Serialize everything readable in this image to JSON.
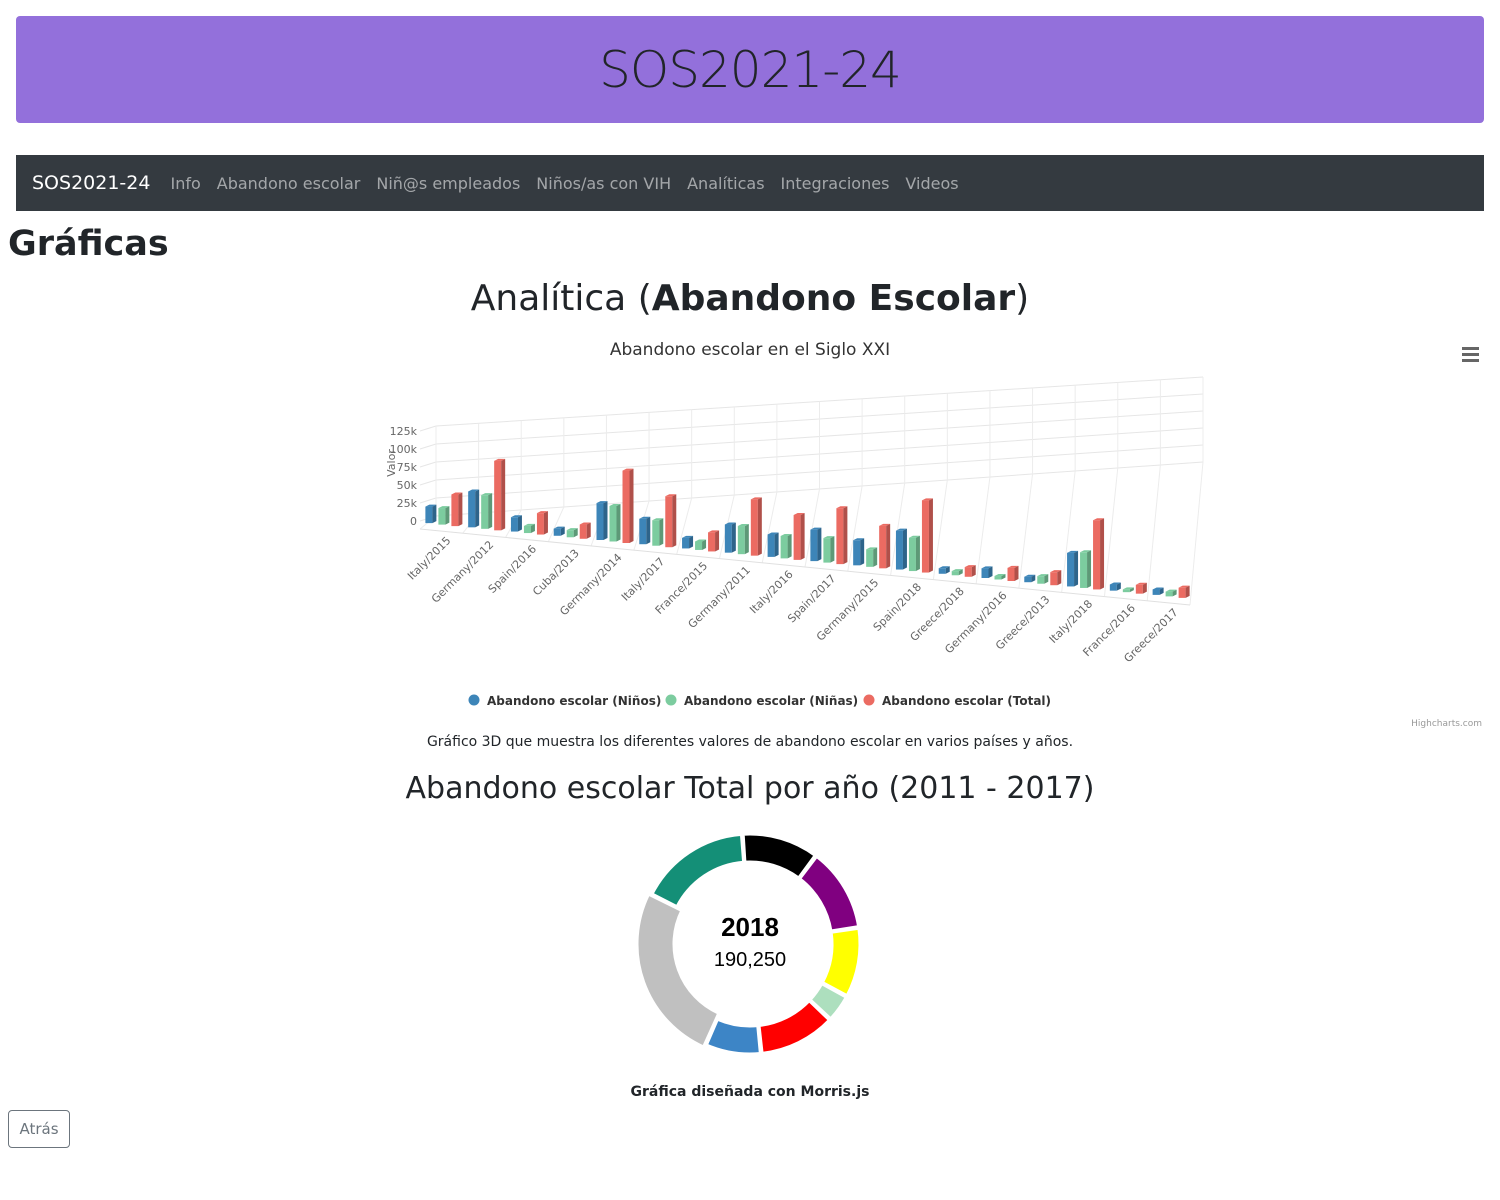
{
  "banner": {
    "title": "SOS2021-24"
  },
  "nav": {
    "brand": "SOS2021-24",
    "links": [
      "Info",
      "Abandono escolar",
      "Niñ@s empleados",
      "Niños/as con VIH",
      "Analíticas",
      "Integraciones",
      "Videos"
    ]
  },
  "page": {
    "heading": "Gráficas",
    "section1_prefix": "Analítica (",
    "section1_bold": "Abandono Escolar",
    "section1_suffix": ")",
    "chart1_description": "Gráfico 3D que muestra los diferentes valores de abandono escolar en varios países y años.",
    "section2_title": "Abandono escolar Total por año (2011 - 2017)",
    "morris_caption": "Gráfica diseñada con Morris.js",
    "back_button": "Atrás"
  },
  "colors": {
    "banner": "#9370db",
    "navbar": "#343a40",
    "ninos": "#3d85b8",
    "ninas": "#7ccc9f",
    "total": "#eb6b62"
  },
  "chart_data": [
    {
      "type": "bar",
      "title": "Abandono escolar en el Siglo XXI",
      "ylabel": "Valor",
      "ylim": [
        0,
        125000
      ],
      "yticks": [
        "0",
        "25k",
        "50k",
        "75k",
        "100k",
        "125k"
      ],
      "credits": "Highcharts.com",
      "legend_position": "bottom",
      "grid": true,
      "three_d": true,
      "categories": [
        "Italy/2015",
        "Germany/2012",
        "Spain/2016",
        "Cuba/2013",
        "Germany/2014",
        "Italy/2017",
        "France/2015",
        "Germany/2011",
        "Italy/2016",
        "Spain/2017",
        "Germany/2015",
        "Spain/2018",
        "Greece/2018",
        "Germany/2016",
        "Greece/2013",
        "Italy/2018",
        "France/2016",
        "Greece/2017"
      ],
      "series": [
        {
          "name": "Abandono escolar (Niños)",
          "color": "#3d85b8",
          "values": [
            23000,
            50000,
            20000,
            10000,
            52000,
            36000,
            15000,
            40000,
            32000,
            45000,
            36000,
            56000,
            8000,
            14000,
            8000,
            49000,
            9000,
            8000
          ]
        },
        {
          "name": "Abandono escolar (Niñas)",
          "color": "#7ccc9f",
          "values": [
            23000,
            47000,
            10000,
            10000,
            50000,
            36000,
            12000,
            40000,
            32000,
            35000,
            25000,
            48000,
            6000,
            5000,
            11000,
            52000,
            4000,
            7000
          ]
        },
        {
          "name": "Abandono escolar (Total)",
          "color": "#eb6b62",
          "values": [
            44000,
            97000,
            30000,
            20000,
            102000,
            72000,
            27000,
            80000,
            64000,
            80000,
            61000,
            104000,
            14000,
            19000,
            19000,
            101000,
            13000,
            15000
          ]
        }
      ]
    },
    {
      "type": "pie",
      "title": "Abandono escolar Total por año (2011 - 2017)",
      "selected_label": "2018",
      "selected_value": "190,250",
      "slices": [
        {
          "value": 11,
          "color": "#000000"
        },
        {
          "value": 12,
          "color": "#800080"
        },
        {
          "value": 10,
          "color": "#ffff00"
        },
        {
          "value": 4,
          "color": "#addfbe"
        },
        {
          "value": 11,
          "color": "#ff0000"
        },
        {
          "value": 8,
          "color": "#3d85c6"
        },
        {
          "value": 25,
          "color": "#c0c0c0"
        },
        {
          "value": 16,
          "color": "#148f77"
        }
      ]
    }
  ]
}
